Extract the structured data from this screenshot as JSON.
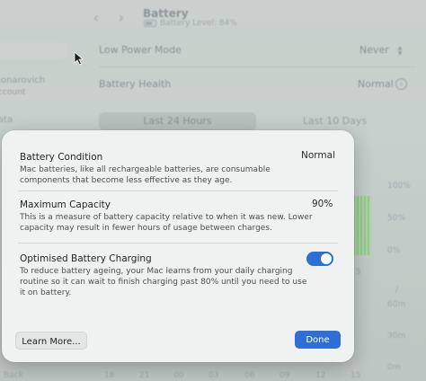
{
  "window": {
    "title": "Battery",
    "subtitle": "Battery Level: 84%",
    "back_icon": "chevron-left-icon",
    "forward_icon": "chevron-right-icon"
  },
  "sidebar": {
    "user_name": "Jonarovich",
    "user_sub": "ccount",
    "item_fragment": "ata"
  },
  "settings": {
    "low_power_mode": {
      "label": "Low Power Mode",
      "value": "Never"
    },
    "battery_health": {
      "label": "Battery Health",
      "value": "Normal"
    },
    "range_tabs": [
      "Last 24 Hours",
      "Last 10 Days"
    ],
    "selected_tab": "Last 24 Hours"
  },
  "chart": {
    "y_labels_level": [
      "100%",
      "50%",
      "0%"
    ],
    "y_labels_time": [
      "60m",
      "30m",
      "0m"
    ],
    "x_labels": [
      "18",
      "21",
      "00",
      "03",
      "06",
      "09",
      "12",
      "15"
    ],
    "fragment_5": "5",
    "back_fragment": "Back",
    "bar_color": "#86c87b"
  },
  "sheet": {
    "condition": {
      "title": "Battery Condition",
      "value": "Normal",
      "desc": "Mac batteries, like all rechargeable batteries, are consumable components that become less effective as they age."
    },
    "capacity": {
      "title": "Maximum Capacity",
      "value": "90%",
      "desc": "This is a measure of battery capacity relative to when it was new. Lower capacity may result in fewer hours of usage between charges."
    },
    "optimised": {
      "title": "Optimised Battery Charging",
      "enabled": true,
      "desc": "To reduce battery ageing, your Mac learns from your daily charging routine so it can wait to finish charging past 80% until you need to use it on battery."
    },
    "learn_more_label": "Learn More...",
    "done_label": "Done",
    "accent": "#2d6fd6"
  }
}
